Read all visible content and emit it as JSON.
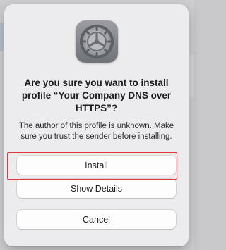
{
  "dialog": {
    "icon": "system-preferences-gear-icon",
    "title": "Are you sure you want to install profile “Your Company DNS over HTTPS”?",
    "message": "The author of this profile is unknown. Make sure you trust the sender before installing.",
    "buttons": {
      "install": "Install",
      "show_details": "Show Details",
      "cancel": "Cancel"
    }
  },
  "colors": {
    "highlight": "#e0393a",
    "dialog_bg": "#ececee",
    "button_bg": "#fdfdfd"
  }
}
